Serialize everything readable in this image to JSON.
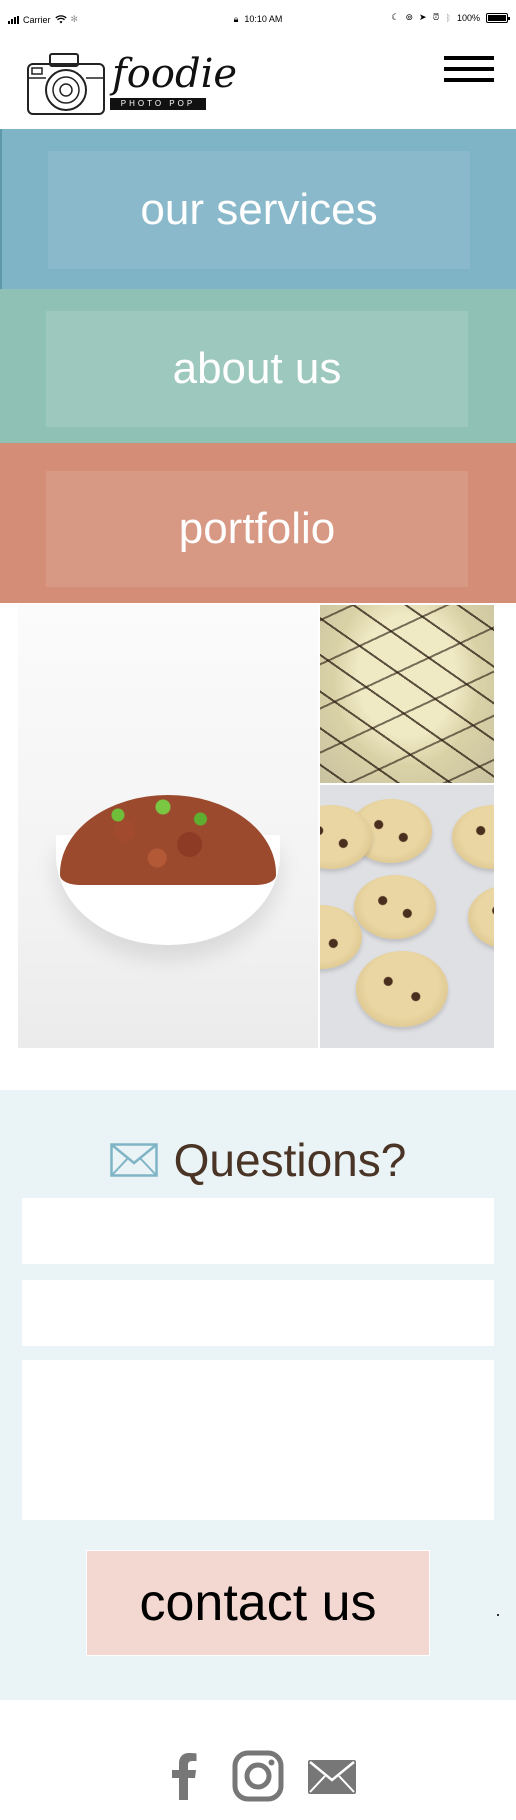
{
  "status_bar": {
    "carrier": "Carrier",
    "time": "10:10 AM",
    "battery": "100%"
  },
  "header": {
    "logo_word": "foodie",
    "logo_sub": "PHOTO POP",
    "menu_icon": "hamburger-menu-icon"
  },
  "nav": {
    "services": "our services",
    "about": "about us",
    "portfolio": "portfolio"
  },
  "colors": {
    "services_band": "#7fb4c6",
    "about_band": "#8fc1b4",
    "portfolio_band": "#d48e77",
    "contact_bg": "#eaf3f5",
    "contact_button": "#f2d8d0",
    "heading_text": "#4a3426"
  },
  "contact": {
    "icon": "envelope-icon",
    "title": "Questions?",
    "field_1_placeholder": "",
    "field_2_placeholder": "",
    "message_placeholder": "",
    "button_label": "contact us"
  },
  "footer": {
    "icons": [
      "facebook-icon",
      "instagram-icon",
      "email-icon"
    ]
  }
}
